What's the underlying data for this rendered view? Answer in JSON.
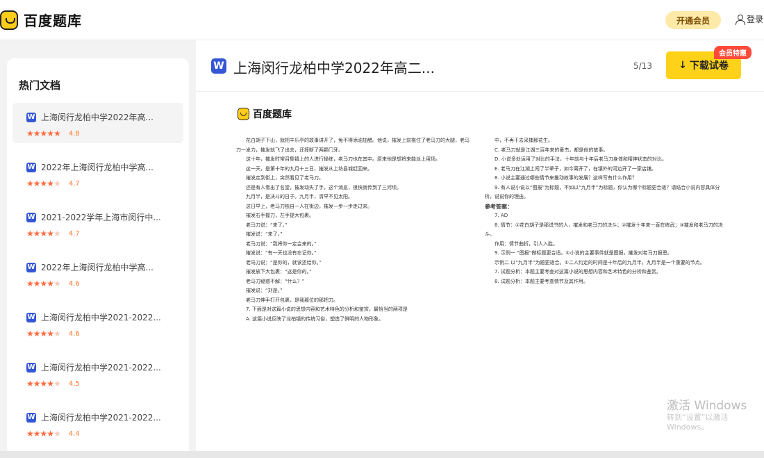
{
  "header": {
    "logo_text": "百度题库",
    "vip_button": "开通会员",
    "login": "登录"
  },
  "sidebar": {
    "title": "热门文档",
    "items": [
      {
        "title": "上海闵行龙柏中学2022年高...",
        "rating": "4.8",
        "stars": 5
      },
      {
        "title": "2022年上海闵行龙柏中学高...",
        "rating": "4.7",
        "stars": 4.5
      },
      {
        "title": "2021-2022学年上海市闵行中...",
        "rating": "4.7",
        "stars": 4.5
      },
      {
        "title": "2022年上海闵行龙柏中学高...",
        "rating": "4.6",
        "stars": 4.5
      },
      {
        "title": "上海闵行龙柏中学2021-2022...",
        "rating": "4.6",
        "stars": 4.5
      },
      {
        "title": "上海闵行龙柏中学2021-2022...",
        "rating": "4.5",
        "stars": 4.5
      },
      {
        "title": "上海闵行龙柏中学2021-2022...",
        "rating": "4.4",
        "stars": 4.5
      }
    ]
  },
  "document": {
    "title": "上海闵行龙柏中学2022年高二...",
    "page_indicator": "5/13",
    "download_button": "下载试卷",
    "vip_tag": "会员特惠",
    "page_logo": "百度题库",
    "left_column": [
      "花白胡子下山，就把丰乐亭的故事讲开了，免不得添油加醋。他说，摧发上前拖住了老马刀的大腿，老马刀一发力，摧发就飞了出去，还摔断了两颗门牙。",
      "这十年，摧发时常召集镇上的人进行操练，老马刀也在其中。原来他是想将来能派上用场。",
      "这一天，是第十年的九月十三日，摧发从上坊县城赶回来。",
      "摧发走到街上，突然看见了老马刀。",
      "还是有人看出了名堂，摧发动失了手，这个消息，很快就传到了三河坝。",
      "九月半，是决斗的日子。九月半，清早不见太阳。",
      "这日早上，老马刀独自一人在街边，摧发一步一步走过来。",
      "摧发右手握刀，左手提大包裹。",
      "老马刀说：“来了。”",
      "摧发说：“来了。”",
      "老马刀说：“我将你一定会来的。”",
      "摧发说：“有一天也没有忘记你。”",
      "老马刀说：“是你的，就该还给你。”",
      "摧发放下大包裹：“这是你的。”",
      "老马刀疑惑不解：“什么？”",
      "摧发说：“刘是。”",
      "老马刀伸手打开包裹，是我那位的那把刀。",
      "7. 下面是对这篇小说的思想内容和艺术特色的分析和鉴赏，最恰当的两项是",
      "A. 这篇小说反映了龙柏镇的传统习俗，塑造了鲜明的人物形象。"
    ],
    "right_column": [
      "中，不再干去采捕那花生。",
      "C. 老马刀就是江湖三百年来的豪杰，都是他的故事。",
      "D. 小说多处运用了对比的手法，十年前与十年后老马刀身体和精神状态的对比。",
      "E. 老马刀在江湖上闯了半辈子，如今离开了，在镇外的河边开了一家店铺。",
      "8. 小说主要通过哪些情节来推动故事的发展？这样写有什么作用？",
      "9. 有人说小说以“图报”为标题，不如以“九月半”为标题，你认为哪个标题更合适？请结合小说内容具体分析，说说你的理由。",
      "参考答案：",
      "7. AD",
      "8. 情节：①花白胡子是那说书的人，摧发和老马刀的决斗；②摧发十年来一直在练武；③摧发和老马刀的决斗。",
      "作用：情节曲折，引人入胜。",
      "9. 示例一 “图报”做标题更合适。①小说的主要事件就是图报，摧发对老马刀报恩。",
      "示例二 以“九月半”为题更适合。①二人约定的时间是十年后的九月半，九月半是一个重要的节点。",
      "7. 试题分析：本题主要考查对这篇小说的思想内容和艺术特色的分析和鉴赏。",
      "8. 试题分析：本题主要考查情节及其作用。"
    ]
  },
  "watermark": {
    "line1": "激活 Windows",
    "line2": "转到“设置”以激活 Windows。"
  },
  "colors": {
    "brand_yellow": "#ffd21a",
    "star": "#ff6a3d",
    "word_blue": "#3557d6",
    "vip_red": "#ff4a3a"
  },
  "icons": {
    "logo": "baidu-tiku-logo-icon",
    "user": "user-icon",
    "word": "word-doc-icon",
    "download": "download-arrow-icon",
    "star": "star-icon"
  }
}
